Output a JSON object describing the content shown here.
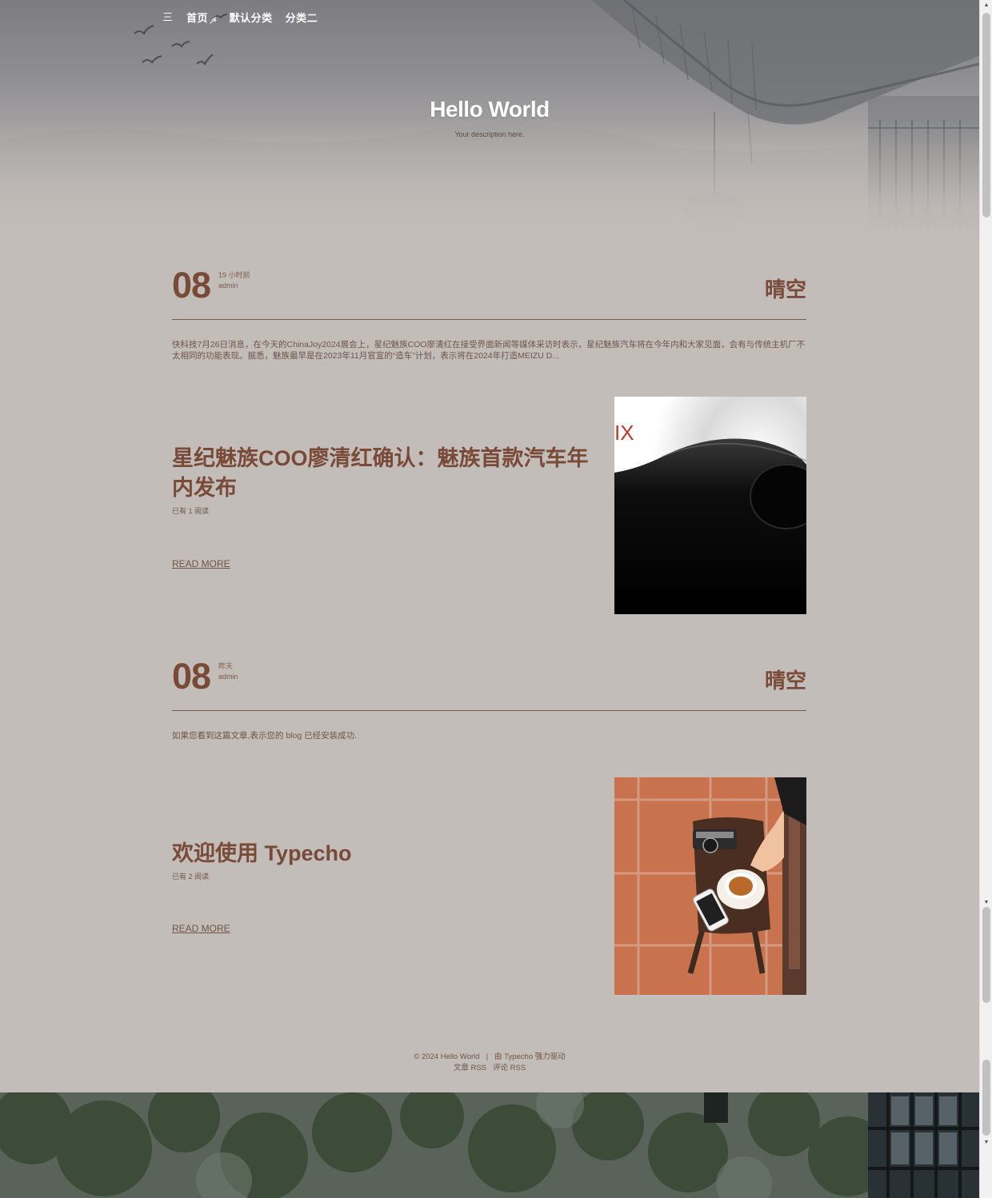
{
  "nav": {
    "menu_icon": "三",
    "items": [
      {
        "label": "首页"
      },
      {
        "label": "默认分类"
      },
      {
        "label": "分类二"
      }
    ],
    "home_leaf": "𝓅"
  },
  "site": {
    "title": "Hello World",
    "description": "Your description here."
  },
  "posts": [
    {
      "day": "08",
      "time": "19 小时前",
      "author": "admin",
      "weather": "晴空",
      "excerpt": "快科技7月26日消息，在今天的ChinaJoy2024展会上，星纪魅族COO廖清红在接受界面新闻等媒体采访时表示，星纪魅族汽车将在今年内和大家见面，会有与传统主机厂不太相同的功能表现。据悉，魅族最早是在2023年11月官宣的“造车”计划，表示将在2024年打造MEIZU D...",
      "title_line1": "星纪魅族COO廖清红确认：魅族首款汽车年",
      "title_line2": "内发布",
      "reads": "已有 1 阅读",
      "read_more": "READ MORE",
      "thumb_label": "IX"
    },
    {
      "day": "08",
      "time": "昨天",
      "author": "admin",
      "weather": "晴空",
      "excerpt": "如果您看到这篇文章,表示您的 blog 已经安装成功.",
      "title_line1": "欢迎使用 Typecho",
      "reads": "已有 2 阅读",
      "read_more": "READ MORE"
    }
  ],
  "footer": {
    "copyright": "© 2024 Hello World",
    "separator": "|",
    "powered": "由 Typecho 强力驱动",
    "rss_posts": "文章 RSS",
    "rss_comments": "评论 RSS"
  },
  "colors": {
    "accent": "#7a4a38",
    "background": "#c3bdb9",
    "text": "#6e5548"
  }
}
